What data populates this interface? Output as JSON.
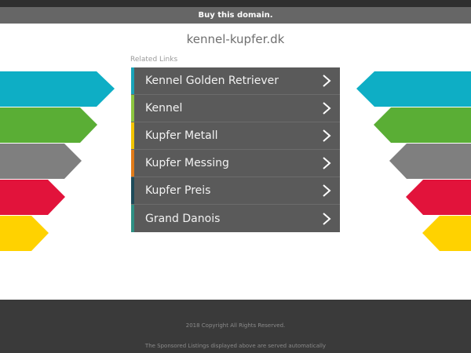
{
  "buy_bar": {
    "label": "Buy this domain."
  },
  "domain": "kennel-kupfer.dk",
  "related_links": {
    "title": "Related Links",
    "items": [
      {
        "label": "Kennel Golden Retriever",
        "accent": "#1aa3b8"
      },
      {
        "label": "Kennel",
        "accent": "#8cc63f"
      },
      {
        "label": "Kupfer Metall",
        "accent": "#f2c400"
      },
      {
        "label": "Kupfer Messing",
        "accent": "#e07b1a"
      },
      {
        "label": "Kupfer Preis",
        "accent": "#1e4b5a"
      },
      {
        "label": "Grand Danois",
        "accent": "#2f8f83"
      }
    ]
  },
  "side_arrows": {
    "colors": [
      "#0eaec5",
      "#5aae35",
      "#7f7f7f",
      "#e2133b",
      "#ffd200"
    ]
  },
  "footer": {
    "copyright": "2018 Copyright All Rights Reserved.",
    "disclaimer": "The Sponsored Listings displayed above are served automatically"
  }
}
